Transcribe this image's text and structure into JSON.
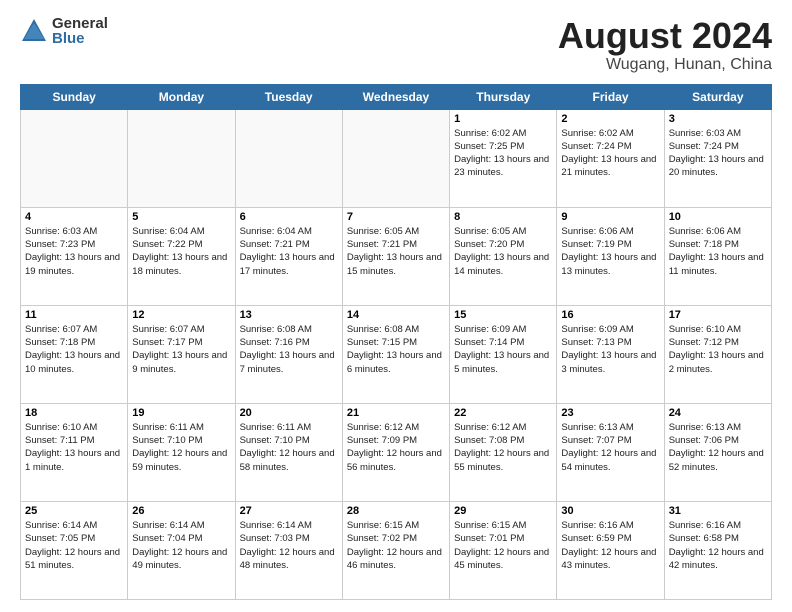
{
  "header": {
    "logo_general": "General",
    "logo_blue": "Blue",
    "month_year": "August 2024",
    "location": "Wugang, Hunan, China"
  },
  "weekdays": [
    "Sunday",
    "Monday",
    "Tuesday",
    "Wednesday",
    "Thursday",
    "Friday",
    "Saturday"
  ],
  "weeks": [
    [
      {
        "day": "",
        "info": ""
      },
      {
        "day": "",
        "info": ""
      },
      {
        "day": "",
        "info": ""
      },
      {
        "day": "",
        "info": ""
      },
      {
        "day": "1",
        "info": "Sunrise: 6:02 AM\nSunset: 7:25 PM\nDaylight: 13 hours\nand 23 minutes."
      },
      {
        "day": "2",
        "info": "Sunrise: 6:02 AM\nSunset: 7:24 PM\nDaylight: 13 hours\nand 21 minutes."
      },
      {
        "day": "3",
        "info": "Sunrise: 6:03 AM\nSunset: 7:24 PM\nDaylight: 13 hours\nand 20 minutes."
      }
    ],
    [
      {
        "day": "4",
        "info": "Sunrise: 6:03 AM\nSunset: 7:23 PM\nDaylight: 13 hours\nand 19 minutes."
      },
      {
        "day": "5",
        "info": "Sunrise: 6:04 AM\nSunset: 7:22 PM\nDaylight: 13 hours\nand 18 minutes."
      },
      {
        "day": "6",
        "info": "Sunrise: 6:04 AM\nSunset: 7:21 PM\nDaylight: 13 hours\nand 17 minutes."
      },
      {
        "day": "7",
        "info": "Sunrise: 6:05 AM\nSunset: 7:21 PM\nDaylight: 13 hours\nand 15 minutes."
      },
      {
        "day": "8",
        "info": "Sunrise: 6:05 AM\nSunset: 7:20 PM\nDaylight: 13 hours\nand 14 minutes."
      },
      {
        "day": "9",
        "info": "Sunrise: 6:06 AM\nSunset: 7:19 PM\nDaylight: 13 hours\nand 13 minutes."
      },
      {
        "day": "10",
        "info": "Sunrise: 6:06 AM\nSunset: 7:18 PM\nDaylight: 13 hours\nand 11 minutes."
      }
    ],
    [
      {
        "day": "11",
        "info": "Sunrise: 6:07 AM\nSunset: 7:18 PM\nDaylight: 13 hours\nand 10 minutes."
      },
      {
        "day": "12",
        "info": "Sunrise: 6:07 AM\nSunset: 7:17 PM\nDaylight: 13 hours\nand 9 minutes."
      },
      {
        "day": "13",
        "info": "Sunrise: 6:08 AM\nSunset: 7:16 PM\nDaylight: 13 hours\nand 7 minutes."
      },
      {
        "day": "14",
        "info": "Sunrise: 6:08 AM\nSunset: 7:15 PM\nDaylight: 13 hours\nand 6 minutes."
      },
      {
        "day": "15",
        "info": "Sunrise: 6:09 AM\nSunset: 7:14 PM\nDaylight: 13 hours\nand 5 minutes."
      },
      {
        "day": "16",
        "info": "Sunrise: 6:09 AM\nSunset: 7:13 PM\nDaylight: 13 hours\nand 3 minutes."
      },
      {
        "day": "17",
        "info": "Sunrise: 6:10 AM\nSunset: 7:12 PM\nDaylight: 13 hours\nand 2 minutes."
      }
    ],
    [
      {
        "day": "18",
        "info": "Sunrise: 6:10 AM\nSunset: 7:11 PM\nDaylight: 13 hours\nand 1 minute."
      },
      {
        "day": "19",
        "info": "Sunrise: 6:11 AM\nSunset: 7:10 PM\nDaylight: 12 hours\nand 59 minutes."
      },
      {
        "day": "20",
        "info": "Sunrise: 6:11 AM\nSunset: 7:10 PM\nDaylight: 12 hours\nand 58 minutes."
      },
      {
        "day": "21",
        "info": "Sunrise: 6:12 AM\nSunset: 7:09 PM\nDaylight: 12 hours\nand 56 minutes."
      },
      {
        "day": "22",
        "info": "Sunrise: 6:12 AM\nSunset: 7:08 PM\nDaylight: 12 hours\nand 55 minutes."
      },
      {
        "day": "23",
        "info": "Sunrise: 6:13 AM\nSunset: 7:07 PM\nDaylight: 12 hours\nand 54 minutes."
      },
      {
        "day": "24",
        "info": "Sunrise: 6:13 AM\nSunset: 7:06 PM\nDaylight: 12 hours\nand 52 minutes."
      }
    ],
    [
      {
        "day": "25",
        "info": "Sunrise: 6:14 AM\nSunset: 7:05 PM\nDaylight: 12 hours\nand 51 minutes."
      },
      {
        "day": "26",
        "info": "Sunrise: 6:14 AM\nSunset: 7:04 PM\nDaylight: 12 hours\nand 49 minutes."
      },
      {
        "day": "27",
        "info": "Sunrise: 6:14 AM\nSunset: 7:03 PM\nDaylight: 12 hours\nand 48 minutes."
      },
      {
        "day": "28",
        "info": "Sunrise: 6:15 AM\nSunset: 7:02 PM\nDaylight: 12 hours\nand 46 minutes."
      },
      {
        "day": "29",
        "info": "Sunrise: 6:15 AM\nSunset: 7:01 PM\nDaylight: 12 hours\nand 45 minutes."
      },
      {
        "day": "30",
        "info": "Sunrise: 6:16 AM\nSunset: 6:59 PM\nDaylight: 12 hours\nand 43 minutes."
      },
      {
        "day": "31",
        "info": "Sunrise: 6:16 AM\nSunset: 6:58 PM\nDaylight: 12 hours\nand 42 minutes."
      }
    ]
  ]
}
